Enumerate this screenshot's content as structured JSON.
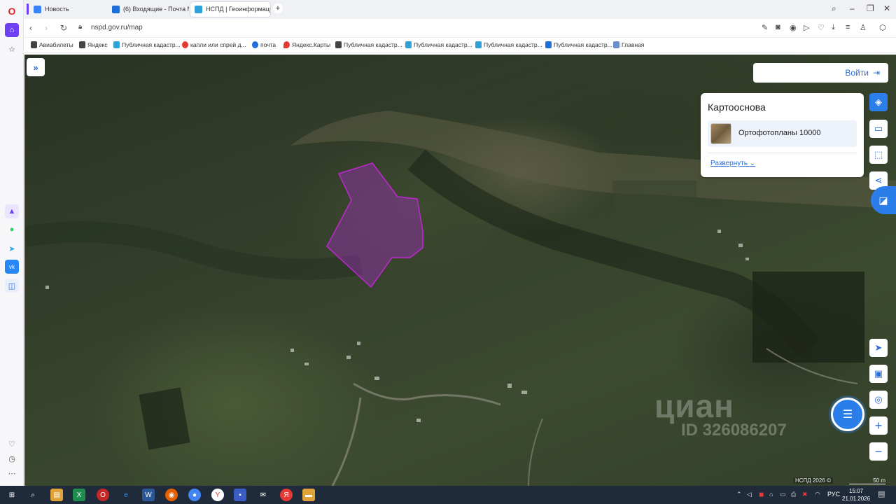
{
  "browser": {
    "tabs": [
      {
        "label": "Новость",
        "favicon_color": "#3b82f6"
      },
      {
        "label": "(6) Входящие - Почта Ма",
        "favicon_color": "#1e6fd9"
      },
      {
        "label": "НСПД | Геоинформаци",
        "favicon_color": "#2fa0d8"
      }
    ],
    "new_tab": "+",
    "url": "nspd.gov.ru/map",
    "bookmarks": [
      {
        "label": "Авиабилеты",
        "color": "#444"
      },
      {
        "label": "Яндекс",
        "color": "#444"
      },
      {
        "label": "Публичная кадастр...",
        "color": "#2fa0d8"
      },
      {
        "label": "капли или спрей д...",
        "color": "#e53935"
      },
      {
        "label": "почта",
        "color": "#1e6fd9"
      },
      {
        "label": "Яндекс.Карты",
        "color": "#e53935"
      },
      {
        "label": "Публичная кадастр...",
        "color": "#444"
      },
      {
        "label": "Публичная кадастр...",
        "color": "#2fa0d8"
      },
      {
        "label": "Публичная кадастр...",
        "color": "#2fa0d8"
      },
      {
        "label": "Публичная кадастр...",
        "color": "#1e6fd9"
      },
      {
        "label": "Главная",
        "color": "#6b8ec9"
      }
    ]
  },
  "map": {
    "login_label": "Войти",
    "panel": {
      "title": "Картооснова",
      "layer": "Ортофотопланы 10000",
      "expand": "Развернуть"
    },
    "watermark_brand": "циан",
    "watermark_id": "ID 326086207",
    "attribution": "НСПД 2026 ©",
    "scale": "50 m",
    "accent_color": "#2b7de9",
    "parcel_color": "#c026d3"
  },
  "taskbar": {
    "lang": "РУС",
    "time": "15:07",
    "date": "21.01.2026"
  }
}
